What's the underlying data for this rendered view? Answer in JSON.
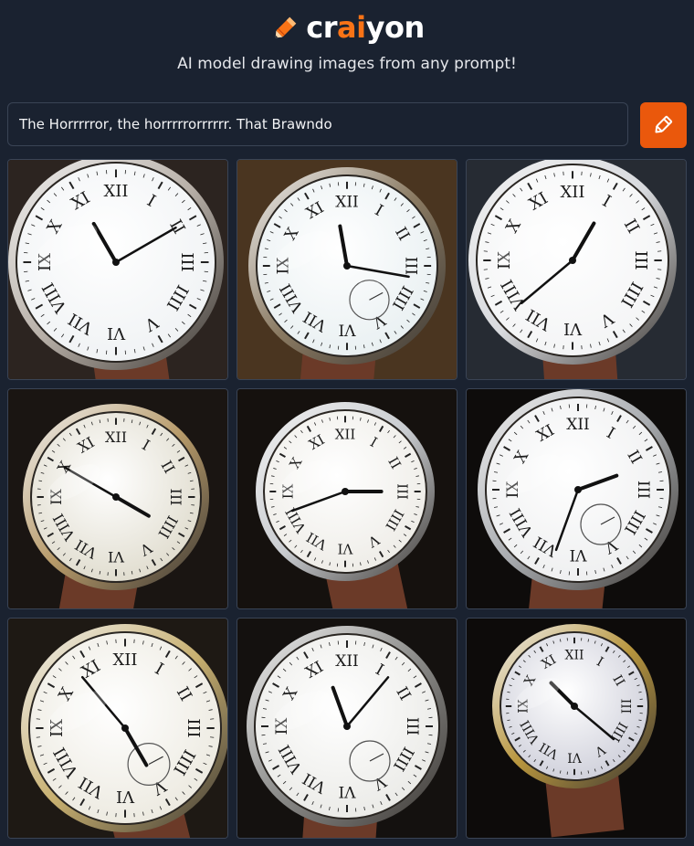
{
  "logo": {
    "prefix": "cr",
    "accent": "ai",
    "suffix": "yon",
    "icon": "pencil-icon",
    "accent_color": "#f97316"
  },
  "tagline": "AI model drawing images from any prompt!",
  "prompt": {
    "value": "The Horrrrror, the horrrrrorrrrrr. That Brawndo"
  },
  "draw_button": {
    "icon": "pencil-icon",
    "color": "#ea580c"
  },
  "images": [
    {
      "subject": "wristwatch",
      "bg": "#2c2420",
      "case": "#b8b0a8",
      "dial": "#eef1f3"
    },
    {
      "subject": "wristwatch",
      "bg": "#4a3520",
      "case": "#8a7a62",
      "dial": "#e6eef0"
    },
    {
      "subject": "wristwatch",
      "bg": "#262b33",
      "case": "#d8dade",
      "dial": "#f2f3f4"
    },
    {
      "subject": "wristwatch",
      "bg": "#1a1512",
      "case": "#b89b6a",
      "dial": "#dcd8c8"
    },
    {
      "subject": "wristwatch",
      "bg": "#15110e",
      "case": "#c9ccd0",
      "dial": "#eceae4"
    },
    {
      "subject": "wristwatch",
      "bg": "#0e0c0b",
      "case": "#a9acb0",
      "dial": "#ecedee"
    },
    {
      "subject": "wristwatch",
      "bg": "#1e1914",
      "case": "#c8b070",
      "dial": "#eae7dc"
    },
    {
      "subject": "wristwatch",
      "bg": "#14110f",
      "case": "#8c8c8a",
      "dial": "#e8e8e4"
    },
    {
      "subject": "wristwatch",
      "bg": "#0d0b0a",
      "case": "#b8963e",
      "dial": "#c9cad6"
    }
  ]
}
